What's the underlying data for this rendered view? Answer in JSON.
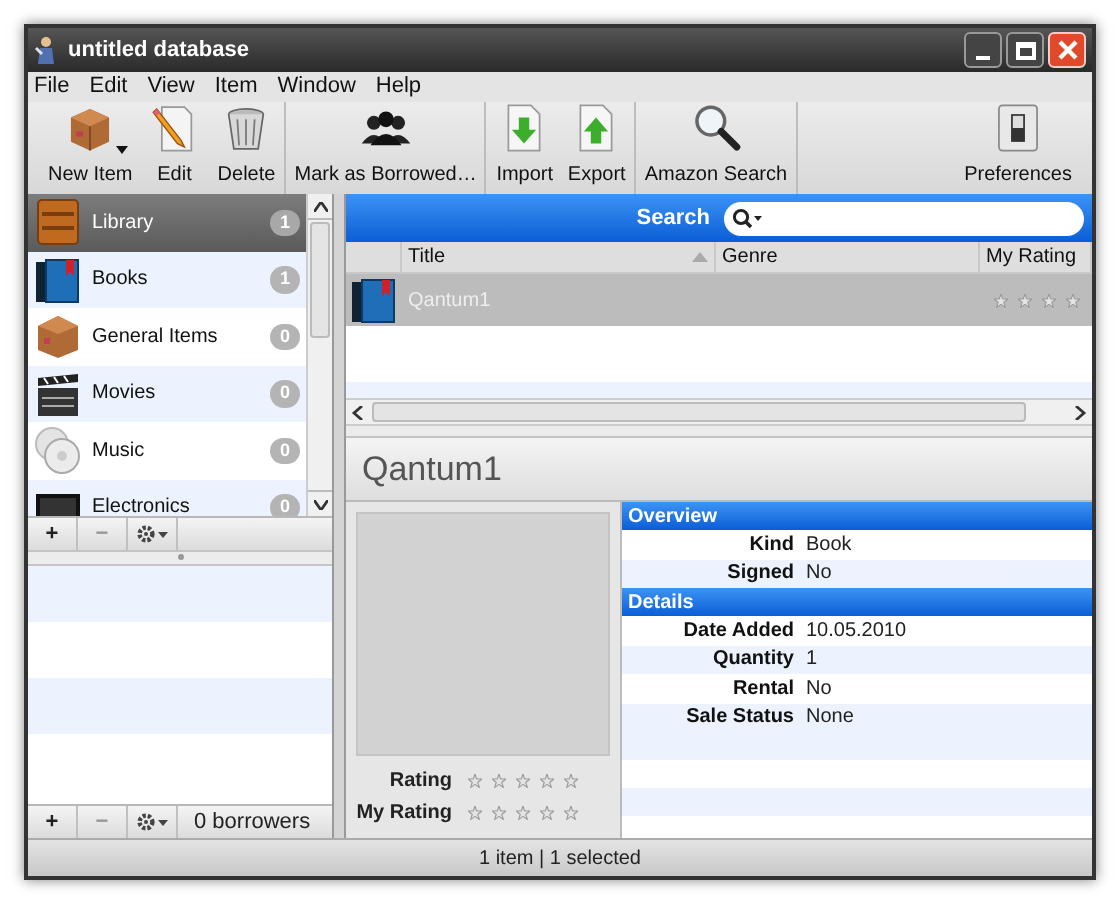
{
  "window": {
    "title": "untitled database"
  },
  "menu": [
    "File",
    "Edit",
    "View",
    "Item",
    "Window",
    "Help"
  ],
  "toolbar": [
    [
      {
        "label": "New Item",
        "kind": "box",
        "dropdown": true
      },
      {
        "label": "Edit",
        "kind": "pencil",
        "dropdown": false
      },
      {
        "label": "Delete",
        "kind": "trash",
        "dropdown": false
      }
    ],
    [
      {
        "label": "Mark as Borrowed…",
        "kind": "people",
        "dropdown": false
      }
    ],
    [
      {
        "label": "Import",
        "kind": "import",
        "dropdown": false
      },
      {
        "label": "Export",
        "kind": "export",
        "dropdown": false
      }
    ],
    [
      {
        "label": "Amazon Search",
        "kind": "magnifier",
        "dropdown": false
      }
    ],
    [
      {
        "label": "Preferences",
        "kind": "switch",
        "dropdown": false
      }
    ]
  ],
  "sidebar": {
    "items": [
      {
        "label": "Library",
        "count": "1",
        "kind": "library",
        "selected": true
      },
      {
        "label": "Books",
        "count": "1",
        "kind": "books",
        "selected": false
      },
      {
        "label": "General Items",
        "count": "0",
        "kind": "box",
        "selected": false
      },
      {
        "label": "Movies",
        "count": "0",
        "kind": "movies",
        "selected": false
      },
      {
        "label": "Music",
        "count": "0",
        "kind": "music",
        "selected": false
      },
      {
        "label": "Electronics",
        "count": "0",
        "kind": "electronics",
        "selected": false
      }
    ],
    "buttons": [
      "+",
      "−"
    ]
  },
  "borrowers": {
    "buttons": [
      "+",
      "−"
    ],
    "count": "0 borrowers"
  },
  "search": {
    "label": "Search"
  },
  "table": {
    "columns": [
      "Title",
      "Genre",
      "My Rating"
    ],
    "rows": [
      {
        "title": "Qantum1",
        "kind": "books",
        "selected": true,
        "stars": 0
      }
    ]
  },
  "detail": {
    "title": "Qantum1",
    "ratings": [
      {
        "label": "Rating",
        "stars": 0
      },
      {
        "label": "My Rating",
        "stars": 0
      }
    ],
    "sections": [
      {
        "heading": "Overview",
        "fields": [
          {
            "label": "Kind",
            "value": "Book"
          },
          {
            "label": "Signed",
            "value": "No"
          }
        ]
      },
      {
        "heading": "Details",
        "fields": [
          {
            "label": "Date Added",
            "value": "10.05.2010"
          },
          {
            "label": "Quantity",
            "value": "1"
          },
          {
            "label": "Rental",
            "value": "No"
          },
          {
            "label": "Sale Status",
            "value": "None"
          }
        ]
      }
    ]
  },
  "status_bar": "1 item | 1 selected"
}
